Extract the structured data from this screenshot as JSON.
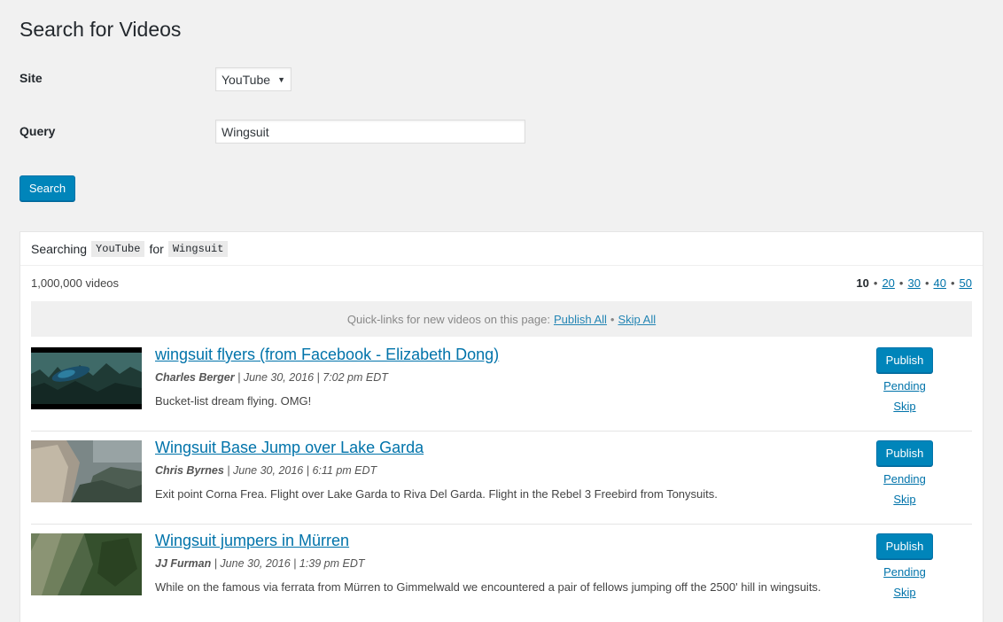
{
  "page": {
    "title": "Search for Videos"
  },
  "form": {
    "site_label": "Site",
    "site_value": "YouTube",
    "query_label": "Query",
    "query_value": "Wingsuit",
    "search_button": "Search"
  },
  "results": {
    "searching_prefix": "Searching",
    "site_code": "YouTube",
    "for_word": "for",
    "query_code": "Wingsuit",
    "count": "1,000,000 videos",
    "per_page": {
      "current": "10",
      "options": [
        "20",
        "30",
        "40",
        "50"
      ],
      "separator": "•"
    },
    "quicklinks": {
      "text": "Quick-links for new videos on this page:",
      "publish_all": "Publish All",
      "sep": "•",
      "skip_all": "Skip All"
    },
    "videos": [
      {
        "title": "wingsuit flyers (from Facebook - Elizabeth Dong)",
        "author": "Charles Berger",
        "date": "| June 30, 2016 | 7:02 pm EDT",
        "description": "Bucket-list dream flying. OMG!",
        "publish": "Publish",
        "pending": "Pending",
        "skip": "Skip"
      },
      {
        "title": "Wingsuit Base Jump over Lake Garda",
        "author": "Chris Byrnes",
        "date": "| June 30, 2016 | 6:11 pm EDT",
        "description": "Exit point Corna Frea. Flight over Lake Garda to Riva Del Garda. Flight in the Rebel 3 Freebird from Tonysuits.",
        "publish": "Publish",
        "pending": "Pending",
        "skip": "Skip"
      },
      {
        "title": "Wingsuit jumpers in Mürren",
        "author": "JJ Furman",
        "date": "| June 30, 2016 | 1:39 pm EDT",
        "description": "While on the famous via ferrata from Mürren to Gimmelwald we encountered a pair of fellows jumping off the 2500' hill in wingsuits.",
        "publish": "Publish",
        "pending": "Pending",
        "skip": "Skip"
      }
    ]
  },
  "colors": {
    "primary": "#0085ba",
    "link": "#0073aa",
    "background": "#f1f1f1"
  }
}
